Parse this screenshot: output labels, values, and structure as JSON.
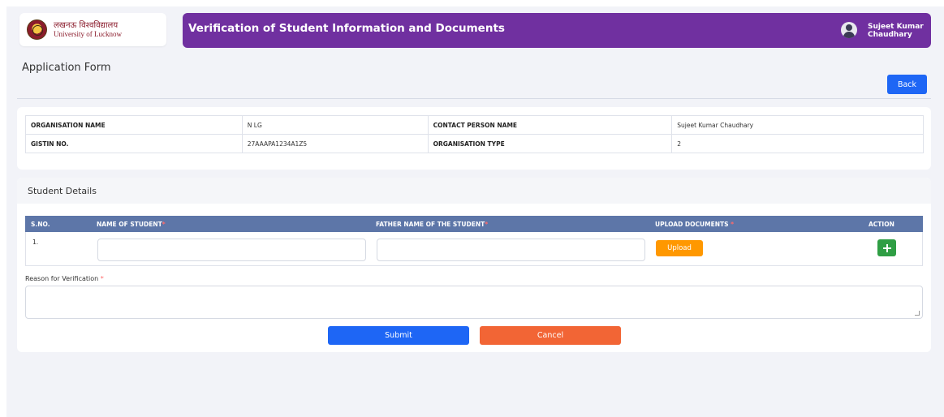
{
  "branding": {
    "hindi_name": "लखनऊ विश्वविद्यालय",
    "english_name": "University of Lucknow",
    "logo_icon": "university-seal-icon"
  },
  "header": {
    "title": "Verification of Student Information and Documents",
    "user_name": "Sujeet Kumar Chaudhary",
    "avatar_icon": "user-avatar-icon",
    "bar_color": "#7030a0"
  },
  "page": {
    "title": "Application Form",
    "back_label": "Back"
  },
  "organisation": {
    "rows": [
      {
        "label1": "ORGANISATION NAME",
        "value1": "N LG",
        "label2": "CONTACT PERSON NAME",
        "value2": "Sujeet Kumar Chaudhary"
      },
      {
        "label1": "GISTIN NO.",
        "value1": "27AAAPA1234A1Z5",
        "label2": "ORGANISATION TYPE",
        "value2": "2"
      }
    ]
  },
  "students": {
    "title": "Student Details",
    "columns": {
      "sno": "S.NO.",
      "name": "NAME OF STUDENT",
      "father": "FATHER NAME OF THE STUDENT",
      "upload": "UPLOAD DOCUMENTS",
      "action": "ACTION"
    },
    "required_mark": "*",
    "rows": [
      {
        "sno": "1.",
        "name_value": "",
        "father_value": "",
        "upload_label": "Upload",
        "add_icon": "plus-icon"
      }
    ]
  },
  "reason": {
    "label": "Reason for Verification",
    "value": ""
  },
  "actions": {
    "submit_label": "Submit",
    "cancel_label": "Cancel"
  },
  "colors": {
    "primary": "#1e66f5",
    "danger": "#f26535",
    "upload": "#ff9800",
    "add": "#2f9e44",
    "table_header": "#5d76a8"
  }
}
